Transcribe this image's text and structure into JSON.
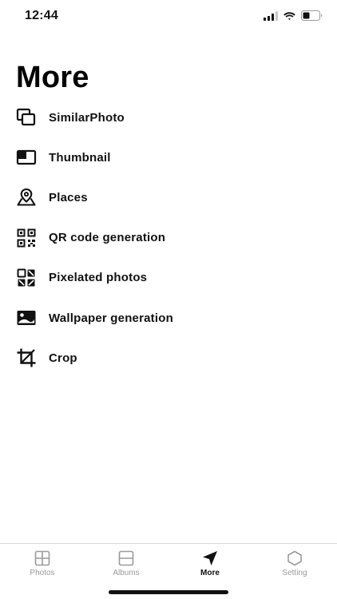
{
  "status_bar": {
    "time": "12:44",
    "icons": [
      "cellular-signal-icon",
      "wifi-icon",
      "battery-icon"
    ]
  },
  "page": {
    "title": "More"
  },
  "menu": {
    "items": [
      {
        "label": "SimilarPhoto",
        "icon": "similar-photo-icon"
      },
      {
        "label": "Thumbnail",
        "icon": "thumbnail-icon"
      },
      {
        "label": "Places",
        "icon": "map-pin-icon"
      },
      {
        "label": "QR code generation",
        "icon": "qr-code-icon"
      },
      {
        "label": "Pixelated photos",
        "icon": "pixelate-icon"
      },
      {
        "label": "Wallpaper generation",
        "icon": "wallpaper-icon"
      },
      {
        "label": "Crop",
        "icon": "crop-icon"
      }
    ]
  },
  "tab_bar": {
    "tabs": [
      {
        "label": "Photos",
        "icon": "photos-grid-icon",
        "active": false
      },
      {
        "label": "Albums",
        "icon": "albums-icon",
        "active": false
      },
      {
        "label": "More",
        "icon": "navigation-arrow-icon",
        "active": true
      },
      {
        "label": "Setting",
        "icon": "hexagon-icon",
        "active": false
      }
    ]
  },
  "colors": {
    "text": "#111111",
    "inactive_tab": "#9a9a9a",
    "divider": "#d9d9d9",
    "background": "#ffffff"
  }
}
